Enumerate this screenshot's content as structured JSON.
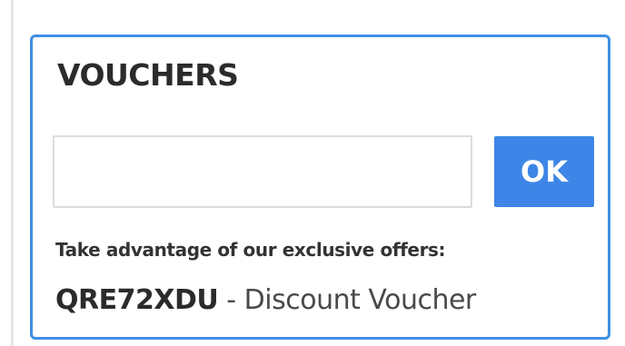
{
  "vouchers": {
    "title": "VOUCHERS",
    "input_value": "",
    "input_placeholder": "",
    "ok_label": "OK",
    "offer_hint": "Take advantage of our exclusive offers:",
    "offer": {
      "code": "QRE72XDU",
      "separator": " - ",
      "description": "Discount Voucher"
    }
  },
  "colors": {
    "accent": "#3d86e8",
    "panel_border": "#3f8fe6",
    "text_dark": "#2b2b2b"
  }
}
